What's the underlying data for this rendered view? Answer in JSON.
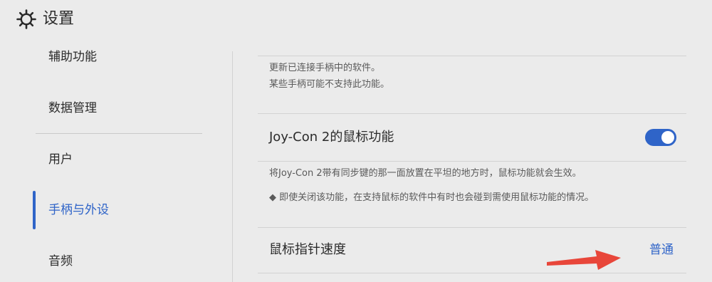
{
  "header": {
    "title": "设置",
    "icon": "gear-icon"
  },
  "sidebar": {
    "items": [
      {
        "label": "辅助功能",
        "active": false
      },
      {
        "label": "数据管理",
        "active": false
      },
      {
        "label": "用户",
        "active": false
      },
      {
        "label": "手柄与外设",
        "active": true
      },
      {
        "label": "音频",
        "active": false
      }
    ]
  },
  "content": {
    "update_desc": {
      "line1": "更新已连接手柄中的软件。",
      "line2": "某些手柄可能不支持此功能。"
    },
    "mouse_function": {
      "label": "Joy-Con 2的鼠标功能",
      "enabled": true,
      "desc1": "将Joy-Con 2带有同步键的那一面放置在平坦的地方时，鼠标功能就会生效。",
      "desc2": "◆ 即使关闭该功能，在支持鼠标的软件中有时也会碰到需使用鼠标功能的情况。"
    },
    "pointer_speed": {
      "label": "鼠标指针速度",
      "value": "普通"
    }
  },
  "colors": {
    "background": "#ebebeb",
    "accent": "#2f64c8",
    "annotation_arrow": "#e8463a"
  }
}
